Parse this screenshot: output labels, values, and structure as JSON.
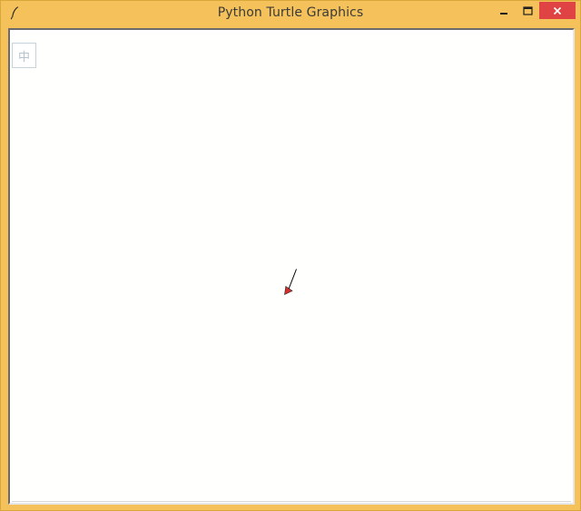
{
  "window": {
    "title": "Python Turtle Graphics",
    "icons": {
      "app": "feather-icon",
      "minimize": "minimize-icon",
      "maximize": "maximize-icon",
      "close": "close-icon"
    },
    "colors": {
      "frame": "#f4c15a",
      "close_button": "#e04343",
      "canvas": "#ffffff"
    }
  },
  "canvas": {
    "ime_indicator": "中",
    "turtle": {
      "shape": "arrow",
      "fill_color": "#d32f2f",
      "pen_color": "#000000",
      "icon": "turtle-arrow-icon"
    }
  }
}
